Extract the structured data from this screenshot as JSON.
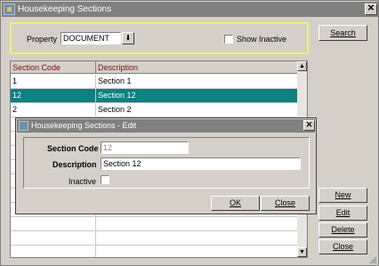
{
  "window": {
    "title": "Housekeeping Sections"
  },
  "filter": {
    "property_label": "Property",
    "property_value": "DOCUMENT",
    "show_inactive_label": "Show Inactive",
    "search_label": "Search"
  },
  "grid": {
    "columns": [
      "Section Code",
      "Description"
    ],
    "rows": [
      {
        "code": "1",
        "description": "Section 1",
        "selected": false
      },
      {
        "code": "12",
        "description": "Section 12",
        "selected": true
      },
      {
        "code": "2",
        "description": "Section 2",
        "selected": false
      }
    ]
  },
  "dialog": {
    "title": "Housekeeping Sections - Edit",
    "section_code_label": "Section Code",
    "section_code_value": "12",
    "description_label": "Description",
    "description_value": "Section 12",
    "inactive_label": "Inactive",
    "ok_label": "OK",
    "close_label": "Close"
  },
  "actions": {
    "new_label": "New",
    "edit_label": "Edit",
    "delete_label": "Delete",
    "close_label": "Close"
  },
  "colors": {
    "selected_row": "#0f7f7f",
    "header_text": "#7b1010",
    "filter_border": "#f0f070",
    "titlebar": "#808080"
  }
}
